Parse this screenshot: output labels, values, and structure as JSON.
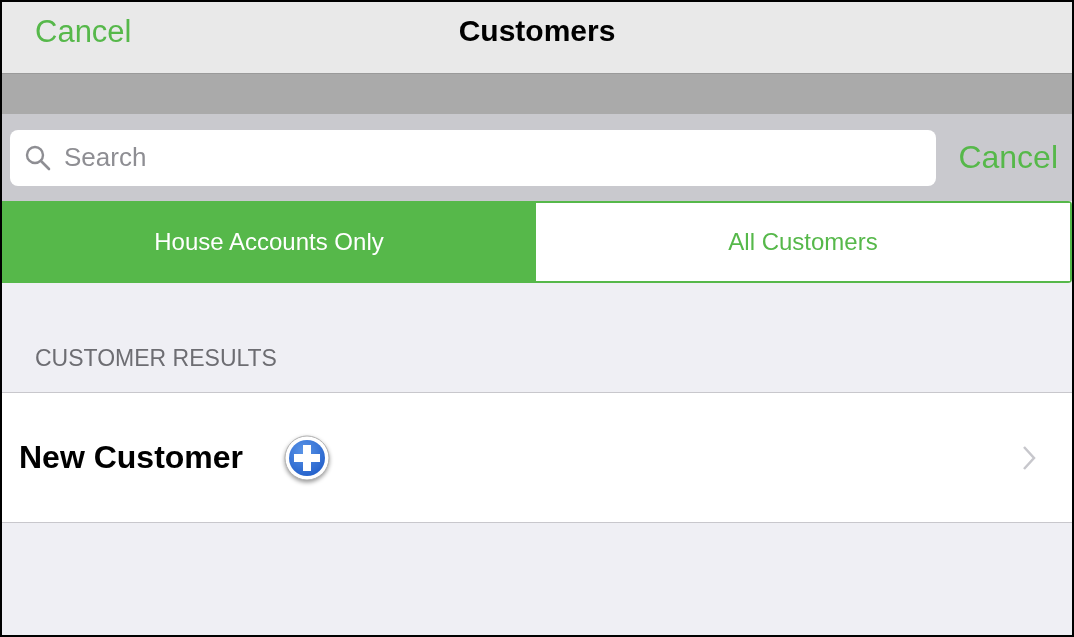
{
  "nav_bar": {
    "left_button": "Cancel",
    "title": "Customers"
  },
  "search": {
    "placeholder": "Search",
    "cancel": "Cancel"
  },
  "segments": [
    {
      "label": "House Accounts Only",
      "selected": true
    },
    {
      "label": "All Customers",
      "selected": false
    }
  ],
  "section_header": "CUSTOMER RESULTS",
  "rows": [
    {
      "label": "New Customer",
      "kind": "add"
    }
  ]
}
